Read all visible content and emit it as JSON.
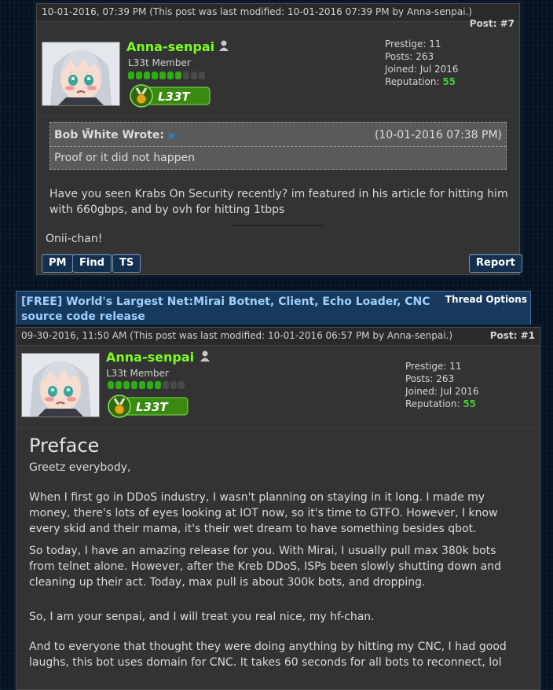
{
  "post7": {
    "date": "10-01-2016, 07:39 PM",
    "modified": "(This post was last modified: 10-01-2016 07:39 PM by",
    "modified_by": "Anna-senpai.)",
    "post_label": "Post:",
    "post_num": "#7",
    "username": "Anna-senpai",
    "user_title": "L33t Member",
    "badge_text": "L33T",
    "stats": {
      "prestige_label": "Prestige:",
      "prestige": "11",
      "posts_label": "Posts:",
      "posts": "263",
      "joined_label": "Joined:",
      "joined": "Jul 2016",
      "rep_label": "Reputation:",
      "rep": "55"
    },
    "quote": {
      "author": "Bob Ŵhite Wrote:",
      "date": "(10-01-2016 07:38 PM)",
      "text": "Proof or it did not happen"
    },
    "body": "Have you seen Krabs On Security recently? im featured in his article for hitting him with 660gbps, and by ovh for hitting 1tbps",
    "signature": "Onii-chan!",
    "buttons": {
      "pm": "PM",
      "find": "Find",
      "ts": "TS",
      "report": "Report"
    }
  },
  "thread": {
    "title": "[FREE] World's Largest Net:Mirai Botnet, Client, Echo Loader, CNC source code release",
    "options": "Thread Options"
  },
  "post1": {
    "date": "09-30-2016, 11:50 AM",
    "modified": "(This post was last modified: 10-01-2016 06:57 PM by",
    "modified_by": "Anna-senpai.)",
    "post_label": "Post:",
    "post_num": "#1",
    "username": "Anna-senpai",
    "user_title": "L33t Member",
    "badge_text": "L33T",
    "stats": {
      "prestige_label": "Prestige:",
      "prestige": "11",
      "posts_label": "Posts:",
      "posts": "263",
      "joined_label": "Joined:",
      "joined": "Jul 2016",
      "rep_label": "Reputation:",
      "rep": "55"
    },
    "heading": "Preface",
    "paragraphs": [
      "Greetz everybody,",
      "When I first go in DDoS industry, I wasn't planning on staying in it long. I made my money, there's lots of eyes looking at IOT now, so it's time to GTFO. However, I know every skid and their mama, it's their wet dream to have something besides qbot.",
      "So today, I have an amazing release for you. With Mirai, I usually pull max 380k bots from telnet alone. However, after the Kreb DDoS, ISPs been slowly shutting down and cleaning up their act. Today, max pull is about 300k bots, and dropping.",
      "So, I am your senpai, and I will treat you real nice, my hf-chan.",
      "And to everyone that thought they were doing anything by hitting my CNC, I had good laughs, this bot uses domain for CNC. It takes 60 seconds for all bots to reconnect, lol"
    ]
  },
  "colors": {
    "username": "#7cfc20",
    "reputation": "#46c83c",
    "thread_title": "#9fd0ff",
    "button_bg": "#143050"
  },
  "icons": [
    "online-status-icon",
    "l33t-medal-icon",
    "quote-arrow-icon"
  ]
}
